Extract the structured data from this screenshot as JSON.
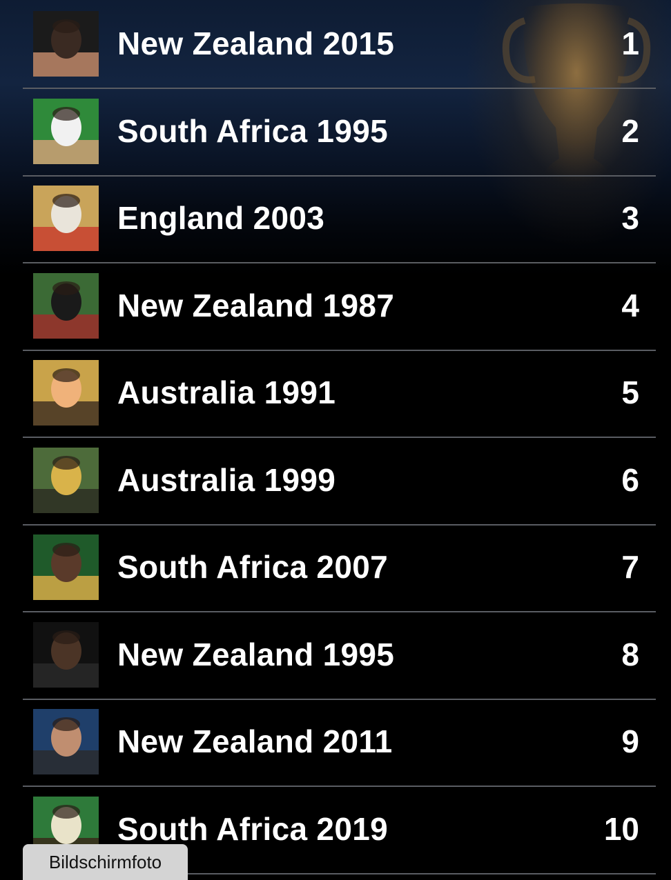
{
  "ranking": {
    "items": [
      {
        "name": "New Zealand 2015",
        "rank": "1",
        "photo": "player-photo"
      },
      {
        "name": "South Africa 1995",
        "rank": "2",
        "photo": "player-photo"
      },
      {
        "name": "England 2003",
        "rank": "3",
        "photo": "team-photo"
      },
      {
        "name": "New Zealand 1987",
        "rank": "4",
        "photo": "team-photo"
      },
      {
        "name": "Australia 1991",
        "rank": "5",
        "photo": "player-photo"
      },
      {
        "name": "Australia 1999",
        "rank": "6",
        "photo": "team-photo"
      },
      {
        "name": "South Africa 2007",
        "rank": "7",
        "photo": "player-photo"
      },
      {
        "name": "New Zealand 1995",
        "rank": "8",
        "photo": "player-photo"
      },
      {
        "name": "New Zealand 2011",
        "rank": "9",
        "photo": "player-photo"
      },
      {
        "name": "South Africa 2019",
        "rank": "10",
        "photo": "player-photo"
      }
    ]
  },
  "tooltip": {
    "label": "Bildschirmfoto"
  },
  "colors": {
    "background": "#000000",
    "text": "#ffffff",
    "separator": "#5a5d63",
    "tooltip_bg": "#d4d4d4"
  }
}
